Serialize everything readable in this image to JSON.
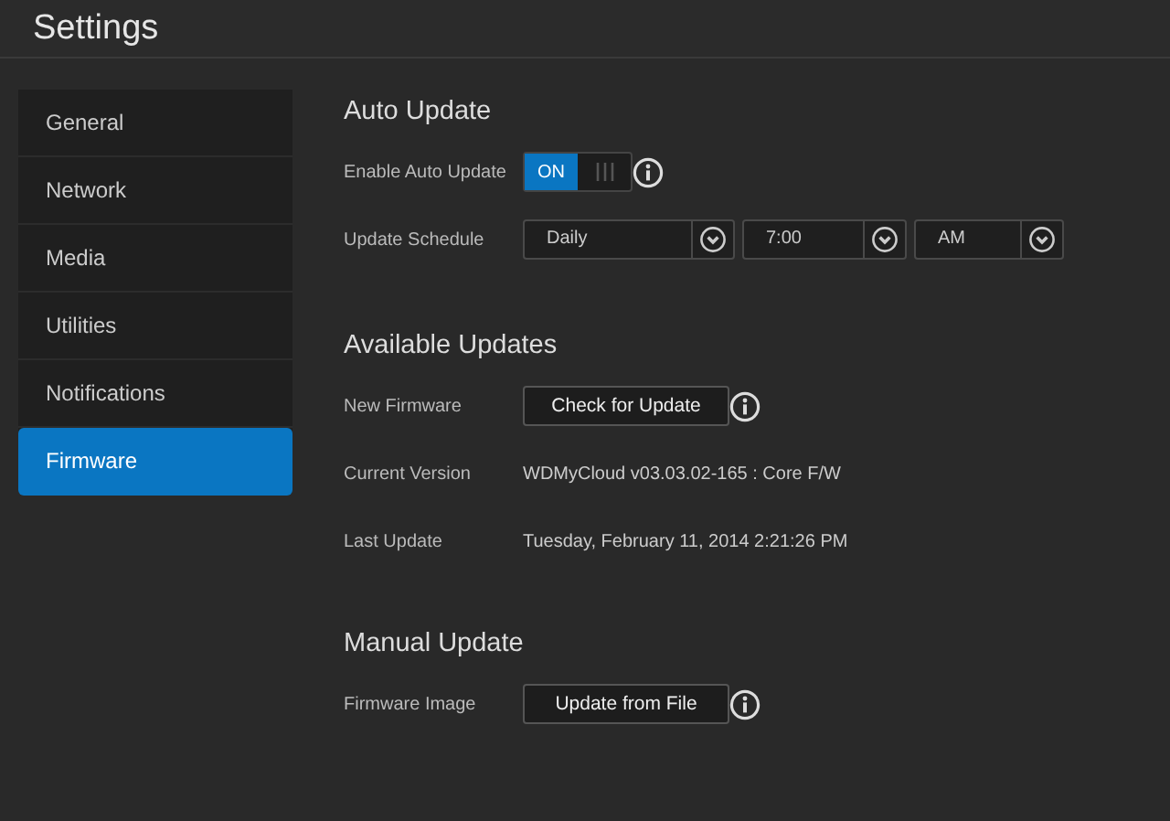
{
  "header": {
    "title": "Settings"
  },
  "sidebar": {
    "items": [
      {
        "label": "General",
        "selected": false
      },
      {
        "label": "Network",
        "selected": false
      },
      {
        "label": "Media",
        "selected": false
      },
      {
        "label": "Utilities",
        "selected": false
      },
      {
        "label": "Notifications",
        "selected": false
      },
      {
        "label": "Firmware",
        "selected": true
      }
    ]
  },
  "sections": [
    {
      "title": "Auto Update",
      "rows": [
        {
          "kind": "toggle",
          "label": "Enable Auto Update",
          "on": true,
          "on_text": "ON",
          "info": true
        },
        {
          "kind": "selects",
          "label": "Update Schedule",
          "selects": [
            "Daily",
            "7:00",
            "AM"
          ]
        }
      ]
    },
    {
      "title": "Available Updates",
      "rows": [
        {
          "kind": "button",
          "label": "New Firmware",
          "button": "Check for Update",
          "info": true
        },
        {
          "kind": "text",
          "label": "Current Version",
          "value": "WDMyCloud v03.03.02-165 : Core F/W"
        },
        {
          "kind": "text",
          "label": "Last Update",
          "value": "Tuesday, February 11, 2014 2:21:26 PM"
        }
      ]
    },
    {
      "title": "Manual Update",
      "rows": [
        {
          "kind": "button",
          "label": "Firmware Image",
          "button": "Update from File",
          "info": true
        }
      ]
    }
  ]
}
